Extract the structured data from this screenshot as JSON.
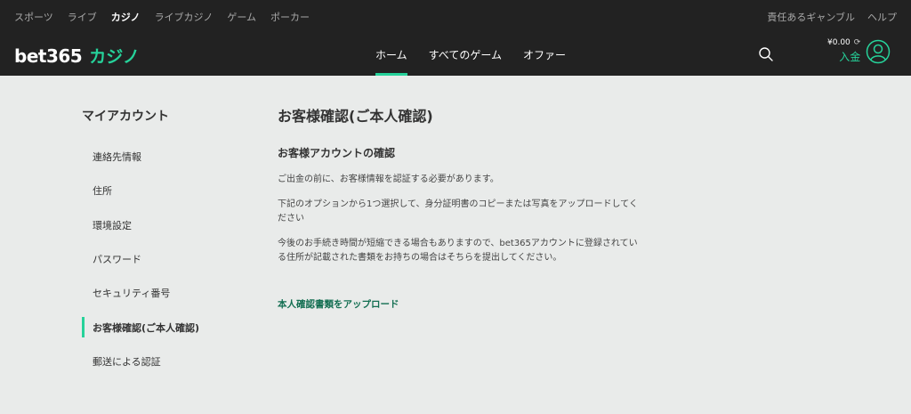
{
  "topbar": {
    "left_links": [
      {
        "label": "スポーツ",
        "active": false
      },
      {
        "label": "ライブ",
        "active": false
      },
      {
        "label": "カジノ",
        "active": true
      },
      {
        "label": "ライブカジノ",
        "active": false
      },
      {
        "label": "ゲーム",
        "active": false
      },
      {
        "label": "ポーカー",
        "active": false
      }
    ],
    "right_links": [
      {
        "label": "責任あるギャンブル"
      },
      {
        "label": "ヘルプ"
      }
    ]
  },
  "header": {
    "brand": "bet365",
    "brand_sub": "カジノ",
    "nav": [
      {
        "label": "ホーム",
        "active": true
      },
      {
        "label": "すべてのゲーム",
        "active": false
      },
      {
        "label": "オファー",
        "active": false
      }
    ],
    "balance": "¥0.00",
    "deposit_label": "入金"
  },
  "sidebar": {
    "title": "マイアカウント",
    "items": [
      {
        "label": "連絡先情報",
        "active": false
      },
      {
        "label": "住所",
        "active": false
      },
      {
        "label": "環境設定",
        "active": false
      },
      {
        "label": "パスワード",
        "active": false
      },
      {
        "label": "セキュリティ番号",
        "active": false
      },
      {
        "label": "お客様確認(ご本人確認)",
        "active": true
      },
      {
        "label": "郵送による認証",
        "active": false
      }
    ]
  },
  "main": {
    "title": "お客様確認(ご本人確認)",
    "section_title": "お客様アカウントの確認",
    "paragraphs": [
      "ご出金の前に、お客様情報を認証する必要があります。",
      "下記のオプションから1つ選択して、身分証明書のコピーまたは写真をアップロードしてください",
      "今後のお手続き時間が短縮できる場合もありますので、bet365アカウントに登録されている住所が記載された書類をお持ちの場合はそちらを提出してください。"
    ],
    "upload_link": "本人確認書類をアップロード"
  },
  "colors": {
    "accent": "#26d29a",
    "link": "#126e51",
    "header_bg": "#222222",
    "page_bg": "#e9ebea"
  },
  "icons": {
    "search": "search-icon",
    "refresh": "refresh-icon",
    "avatar": "user-avatar-icon"
  }
}
